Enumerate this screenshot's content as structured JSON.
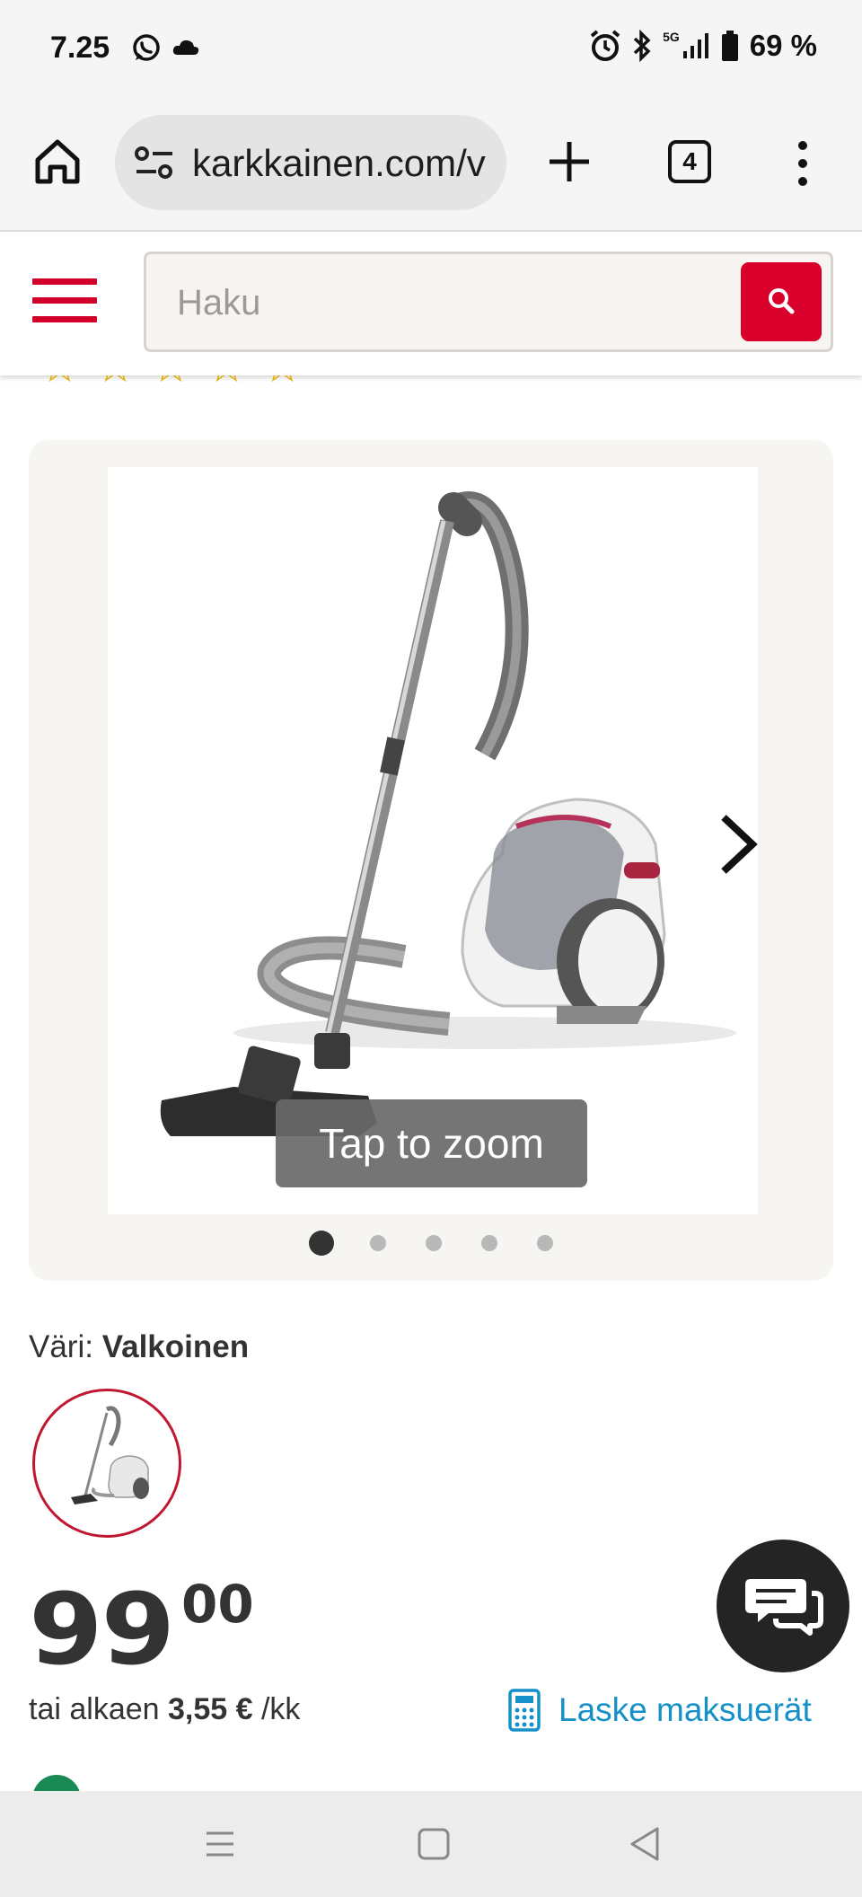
{
  "status_bar": {
    "time": "7.25",
    "network": "5G",
    "battery": "69 %"
  },
  "browser": {
    "url": "karkkainen.com/v",
    "tab_count": "4"
  },
  "header": {
    "search_placeholder": "Haku"
  },
  "gallery": {
    "zoom_hint": "Tap to zoom",
    "image_count": 5,
    "active_index": 0
  },
  "color": {
    "label": "Väri:",
    "value": "Valkoinen"
  },
  "price": {
    "integer": "99",
    "decimals": "00"
  },
  "installment": {
    "prefix": "tai alkaen",
    "amount": "3,55 €",
    "period": "/kk",
    "calc_link": "Laske maksuerät"
  },
  "colors": {
    "brand_red": "#d9002b",
    "link_blue": "#1690c8",
    "star_yellow": "#f3b800",
    "stock_green": "#1a8a54"
  },
  "icons": {
    "status": [
      "whatsapp-icon",
      "cloud-icon",
      "alarm-icon",
      "bluetooth-icon",
      "signal-icon",
      "battery-icon"
    ],
    "browser": [
      "home-icon",
      "site-settings-icon",
      "plus-icon",
      "tabs-icon",
      "more-vertical-icon"
    ],
    "page": [
      "hamburger-icon",
      "search-icon",
      "chevron-right-icon",
      "calculator-icon",
      "chat-icon"
    ],
    "nav": [
      "recents-icon",
      "home-nav-icon",
      "back-icon"
    ]
  }
}
